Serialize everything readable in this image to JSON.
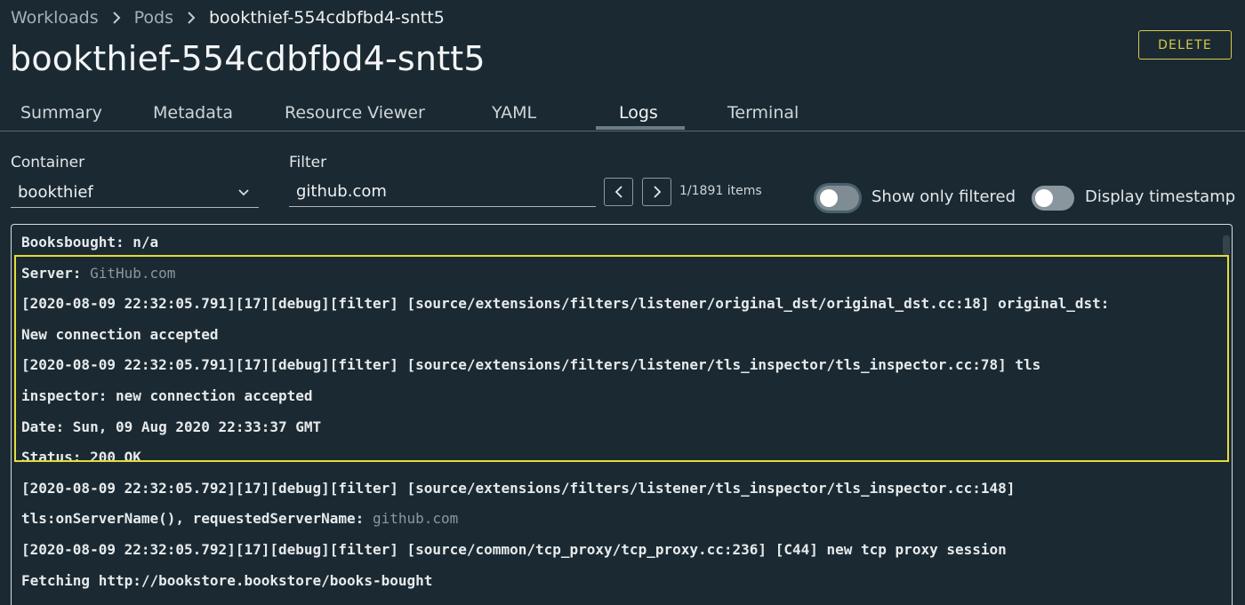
{
  "breadcrumb": {
    "items": [
      "Workloads",
      "Pods",
      "bookthief-554cdbfbd4-sntt5"
    ]
  },
  "page": {
    "title": "bookthief-554cdbfbd4-sntt5",
    "delete_label": "DELETE"
  },
  "tabs": [
    {
      "label": "Summary"
    },
    {
      "label": "Metadata"
    },
    {
      "label": "Resource Viewer"
    },
    {
      "label": "YAML"
    },
    {
      "label": "Logs",
      "active": true
    },
    {
      "label": "Terminal"
    }
  ],
  "controls": {
    "container_label": "Container",
    "container_value": "bookthief",
    "filter_label": "Filter",
    "filter_value": "github.com",
    "prev_label": "<",
    "next_label": ">",
    "count_text": "1/1891 items",
    "show_only_filtered_label": "Show only filtered",
    "display_timestamp_label": "Display timestamp"
  },
  "logs": [
    {
      "main": "Booksbought: n/a",
      "dim": ""
    },
    {
      "main": "Server: ",
      "dim": "GitHub.com"
    },
    {
      "main": "[2020-08-09 22:32:05.791][17][debug][filter] [source/extensions/filters/listener/original_dst/original_dst.cc:18] original_dst:",
      "dim": ""
    },
    {
      "main": "New connection accepted",
      "dim": ""
    },
    {
      "main": "[2020-08-09 22:32:05.791][17][debug][filter] [source/extensions/filters/listener/tls_inspector/tls_inspector.cc:78] tls",
      "dim": ""
    },
    {
      "main": "inspector: new connection accepted",
      "dim": ""
    },
    {
      "main": "Date: Sun, 09 Aug 2020 22:33:37 GMT",
      "dim": ""
    },
    {
      "main": "Status: 200 OK",
      "dim": ""
    },
    {
      "main": "[2020-08-09 22:32:05.792][17][debug][filter] [source/extensions/filters/listener/tls_inspector/tls_inspector.cc:148]",
      "dim": ""
    },
    {
      "main": "tls:onServerName(), requestedServerName: ",
      "dim": "github.com"
    },
    {
      "main": "[2020-08-09 22:32:05.792][17][debug][filter] [source/common/tcp_proxy/tcp_proxy.cc:236] [C44] new tcp proxy session",
      "dim": ""
    },
    {
      "main": "Fetching http://bookstore.bookstore/books-bought",
      "dim": ""
    }
  ],
  "colors": {
    "background": "#1b2a32",
    "highlight": "#e5dc3c",
    "delete_accent": "#d7c94d"
  }
}
